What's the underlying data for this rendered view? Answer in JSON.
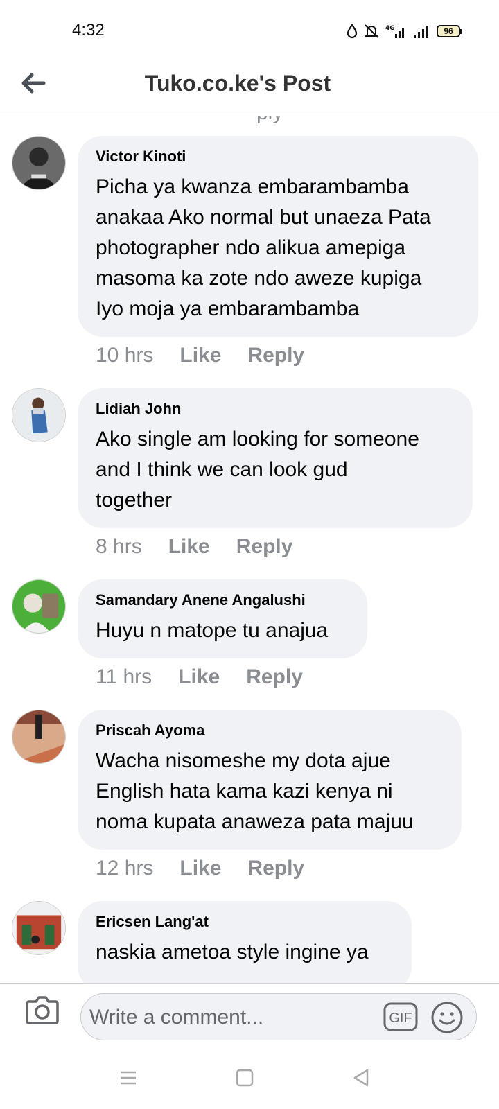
{
  "status_bar": {
    "time": "4:32",
    "network": "4G",
    "battery": "96"
  },
  "header": {
    "title": "Tuko.co.ke's Post",
    "back_icon": "arrow-left-icon"
  },
  "feed": {
    "peek_text": "ply",
    "comments": [
      {
        "author": "Victor Kinoti",
        "text": "Picha ya kwanza embarambamba\nanakaa Ako normal but unaeza Pata\nphotographer ndo alikua amepiga\nmasoma ka zote ndo aweze kupiga\nIyo moja ya embarambamba",
        "time": "10 hrs",
        "like": "Like",
        "reply": "Reply"
      },
      {
        "author": "Lidiah John",
        "text": "Ako single am looking for someone\nand I think we can look gud\ntogether",
        "time": "8 hrs",
        "like": "Like",
        "reply": "Reply"
      },
      {
        "author": "Samandary Anene Angalushi",
        "text": "Huyu n matope tu anajua",
        "time": "11 hrs",
        "like": "Like",
        "reply": "Reply"
      },
      {
        "author": "Priscah Ayoma",
        "text": "Wacha nisomeshe my dota ajue\nEnglish hata kama kazi kenya ni\nnoma kupata anaweza pata majuu",
        "time": "12 hrs",
        "like": "Like",
        "reply": "Reply"
      },
      {
        "author": "Ericsen Lang'at",
        "text": "naskia ametoa style ingine ya",
        "time": "",
        "like": "",
        "reply": ""
      }
    ]
  },
  "composer": {
    "placeholder": "Write a comment...",
    "gif_label": "GIF",
    "camera_icon": "camera-icon",
    "emoji_icon": "emoji-icon"
  },
  "navbar": {
    "icons": [
      "menu-icon",
      "home-square-icon",
      "back-triangle-icon"
    ]
  },
  "colors": {
    "bubble_bg": "#f0f2f5",
    "meta_text": "#8a8d91",
    "primary_text": "#050505"
  }
}
